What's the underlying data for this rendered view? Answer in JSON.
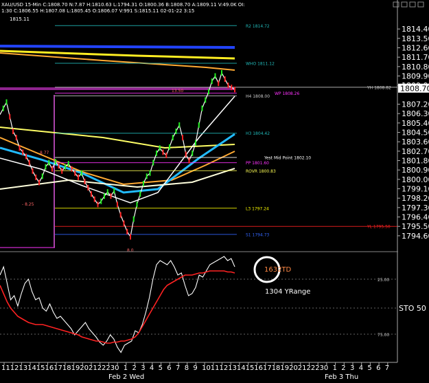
{
  "header": {
    "line1": "XAU/USD  15-Min  C:1808.70  N:7.87  H:1810.63  L:1794.31  O:1800.36  B:1808.70  A:1809.11  V:49.0K  OI:",
    "line2": "1:30  C:1806.55  H:1807.08  L:1805.45  O:1806.07  V:991  S:1815.11  02-01-22  3:15",
    "line3": "1815.11"
  },
  "chart_data": [
    {
      "type": "line",
      "panel": "price",
      "yaxis": {
        "ticks": [
          "1814.40",
          "1813.50",
          "1812.60",
          "1811.70",
          "1810.80",
          "1809.90",
          "1809.00",
          "1807.20",
          "1806.30",
          "1805.40",
          "1804.50",
          "1803.60",
          "1802.70",
          "1801.80",
          "1800.90",
          "1800.00",
          "1799.10",
          "1798.20",
          "1797.30",
          "1796.40",
          "1795.50",
          "1794.60"
        ],
        "range": [
          1794.0,
          1815.2
        ],
        "last_price": "1808.70"
      },
      "x": {
        "labels": [
          "11",
          "12",
          "13",
          "14",
          "15",
          "16",
          "17",
          "18",
          "19",
          "20",
          "21",
          "22",
          "23",
          "0",
          "1",
          "2",
          "3",
          "4",
          "5",
          "6",
          "7",
          "8",
          "9",
          "10",
          "11",
          "12",
          "13",
          "14",
          "15",
          "16",
          "17",
          "18",
          "19",
          "20",
          "21",
          "22",
          "23",
          "0",
          "1",
          "2",
          "3",
          "4",
          "5",
          "6",
          "7"
        ],
        "day_labels": [
          "Feb 2 Wed",
          "Feb 3 Thu"
        ]
      },
      "levels": [
        {
          "label": "R2 1814.72",
          "value": 1814.72,
          "color": "#22bbbb"
        },
        {
          "label": "WHO 1811.12",
          "value": 1811.12,
          "color": "#22bbbb"
        },
        {
          "label": "YH 1808.82",
          "value": 1808.82,
          "color": "#cccccc"
        },
        {
          "label": "WP 1808.26",
          "value": 1808.26,
          "color": "#ff33ff"
        },
        {
          "label": "H4 1808.00",
          "value": 1808.0,
          "color": "#cccccc"
        },
        {
          "label": "H3 1804.42",
          "value": 1804.42,
          "color": "#22bbbb"
        },
        {
          "label": "Yest Mid Point 1802.10",
          "value": 1802.1,
          "color": "#ffffff"
        },
        {
          "label": "PP 1801.60",
          "value": 1801.6,
          "color": "#ff33ff"
        },
        {
          "label": "ROVR 1800.83",
          "value": 1800.83,
          "color": "#ffff55"
        },
        {
          "label": "L3 1797.24",
          "value": 1797.24,
          "color": "#ffff00"
        },
        {
          "label": "YL 1795.50",
          "value": 1795.5,
          "color": "#ff2222"
        },
        {
          "label": "S1 1794.73",
          "value": 1794.73,
          "color": "#3366ff"
        }
      ],
      "annotations": [
        "13.50",
        "- 8.25",
        "8.77",
        "8.0"
      ],
      "series": [
        {
          "color": "#ffffff",
          "values": [
            1806.2,
            1806.8,
            1807.4,
            1806.0,
            1804.6,
            1804.0,
            1803.0,
            1802.6,
            1802.2,
            1801.6,
            1800.8,
            1800.2,
            1799.7,
            1800.3,
            1801.2,
            1801.6,
            1801.0,
            1801.7,
            1801.3,
            1800.8,
            1801.2,
            1801.5,
            1801.0,
            1800.6,
            1800.2,
            1800.6,
            1799.8,
            1799.2,
            1798.6,
            1798.1,
            1797.6,
            1797.9,
            1798.4,
            1798.8,
            1798.4,
            1798.9,
            1797.6,
            1796.6,
            1795.8,
            1795.0,
            1794.5,
            1796.2,
            1797.6,
            1798.6,
            1799.6,
            1800.3,
            1800.6,
            1801.6,
            1802.5,
            1803.0,
            1802.6,
            1802.3,
            1803.1,
            1804.0,
            1804.6,
            1805.2,
            1804.0,
            1802.4,
            1801.8,
            1802.5,
            1803.5,
            1805.2,
            1806.8,
            1807.6,
            1808.4,
            1809.4,
            1809.9,
            1809.2,
            1810.2,
            1809.6,
            1809.0,
            1808.8,
            1808.6
          ]
        }
      ]
    },
    {
      "type": "line",
      "panel": "oscillator",
      "yaxis": {
        "ticks": [
          "25.00",
          "75.00"
        ],
        "label": "STO  50"
      },
      "annotations": [
        "1632TD",
        "1304 YRange"
      ],
      "series": [
        {
          "color": "#ffffff",
          "values": [
            20,
            12,
            28,
            44,
            40,
            50,
            38,
            28,
            24,
            36,
            44,
            42,
            52,
            55,
            48,
            56,
            62,
            60,
            64,
            68,
            72,
            78,
            74,
            70,
            66,
            72,
            76,
            80,
            85,
            88,
            84,
            78,
            82,
            90,
            95,
            88,
            86,
            84,
            74,
            76,
            68,
            56,
            42,
            24,
            10,
            6,
            8,
            10,
            6,
            12,
            20,
            18,
            30,
            40,
            38,
            32,
            20,
            22,
            16,
            10,
            8,
            6,
            4,
            2,
            6,
            4,
            12
          ]
        },
        {
          "color": "#ff2222",
          "values": [
            30,
            38,
            46,
            52,
            56,
            60,
            62,
            64,
            66,
            67,
            68,
            68,
            68,
            69,
            70,
            71,
            72,
            73,
            74,
            75,
            76,
            77,
            78,
            80,
            81,
            82,
            83,
            84,
            84,
            85,
            86,
            86,
            85,
            85,
            84,
            84,
            83,
            82,
            80,
            76,
            70,
            64,
            58,
            52,
            46,
            40,
            34,
            30,
            28,
            26,
            24,
            22,
            20,
            20,
            20,
            19,
            18,
            18,
            17,
            16,
            16,
            16,
            16,
            16,
            17,
            17,
            18
          ]
        }
      ]
    }
  ]
}
